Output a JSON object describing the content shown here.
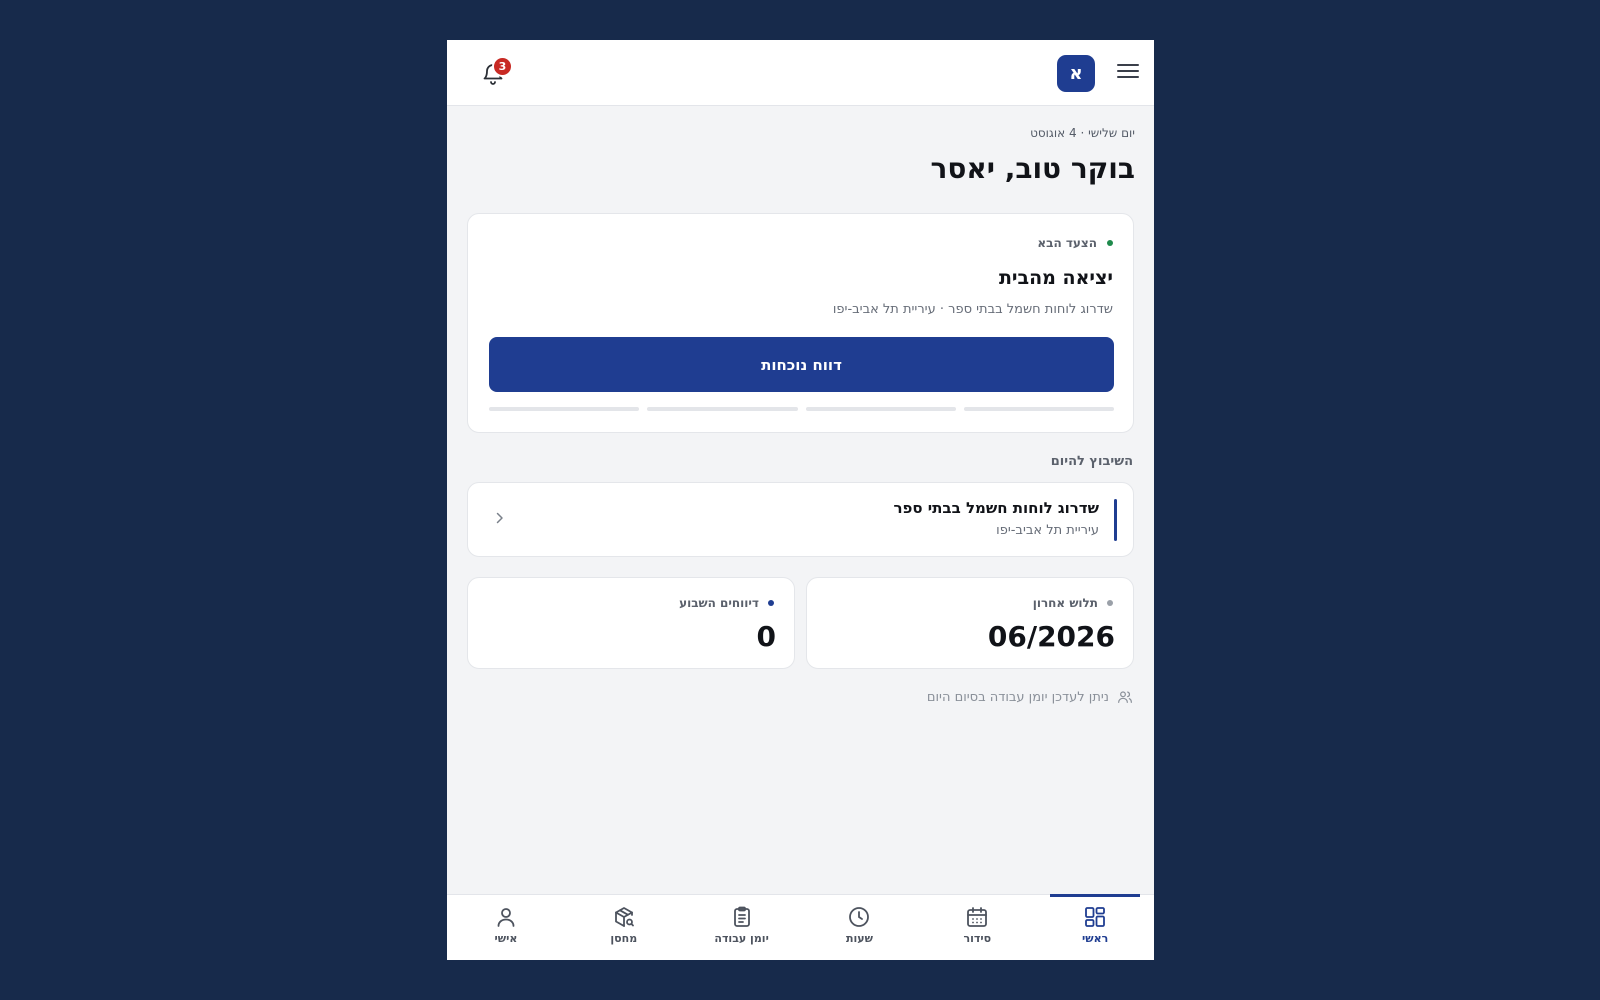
{
  "header": {
    "logo_letter": "א",
    "notification_count": "3",
    "menu_icon": "hamburger-icon",
    "bell_icon": "bell-icon"
  },
  "greeting": {
    "date": "יום שלישי · 4 אוגוסט",
    "title": "בוקר טוב, יאסר"
  },
  "next_step": {
    "label": "הצעד הבא",
    "title": "יציאה מהבית",
    "subtitle": "שדרוג לוחות חשמל בבתי ספר · עיריית תל אביב-יפו",
    "button_label": "דווח נוכחות",
    "status_color": "#1f8a4c"
  },
  "schedule": {
    "section_title": "השיבוץ להיום",
    "title": "שדרוג לוחות חשמל בבתי ספר",
    "subtitle": "עיריית תל אביב-יפו"
  },
  "stats": {
    "last_payslip": {
      "label": "תלוש אחרון",
      "value": "06/2026",
      "dot_color": "#9aa0a8"
    },
    "weekly_reports": {
      "label": "דיווחים השבוע",
      "value": "0",
      "dot_color": "#1f3d91"
    }
  },
  "hint": "ניתן לעדכן יומן עבודה בסיום היום",
  "nav": {
    "items": [
      {
        "label": "ראשי",
        "icon": "dashboard-icon",
        "active": true
      },
      {
        "label": "סידור",
        "icon": "calendar-icon",
        "active": false
      },
      {
        "label": "שעות",
        "icon": "clock-icon",
        "active": false
      },
      {
        "label": "יומן עבודה",
        "icon": "clipboard-icon",
        "active": false
      },
      {
        "label": "מחסן",
        "icon": "package-search-icon",
        "active": false
      },
      {
        "label": "אישי",
        "icon": "user-icon",
        "active": false
      }
    ]
  },
  "colors": {
    "primary": "#1f3d91",
    "background": "#172a4b",
    "badge": "#c82a24"
  }
}
